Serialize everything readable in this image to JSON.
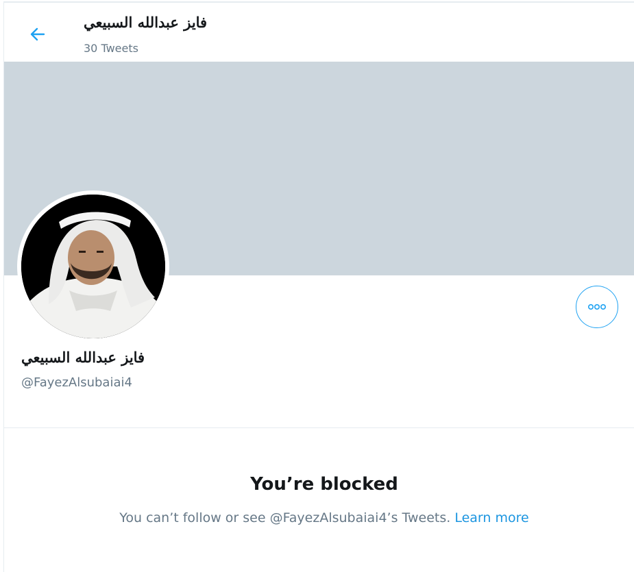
{
  "header": {
    "title": "فايز عبدالله السبيعي",
    "tweet_count": "30 Tweets"
  },
  "profile": {
    "display_name": "فايز عبدالله السبيعي",
    "handle": "@FayezAlsubaiai4"
  },
  "blocked": {
    "title": "You’re blocked",
    "message": "You can’t follow or see @FayezAlsubaiai4’s Tweets.",
    "learn_more": "Learn more"
  },
  "colors": {
    "accent": "#1da1f2",
    "banner": "#ccd6dd",
    "secondary_text": "#657786",
    "link": "#1b95e0"
  },
  "icons": {
    "back": "arrow-left-icon",
    "more": "more-horizontal-icon"
  }
}
